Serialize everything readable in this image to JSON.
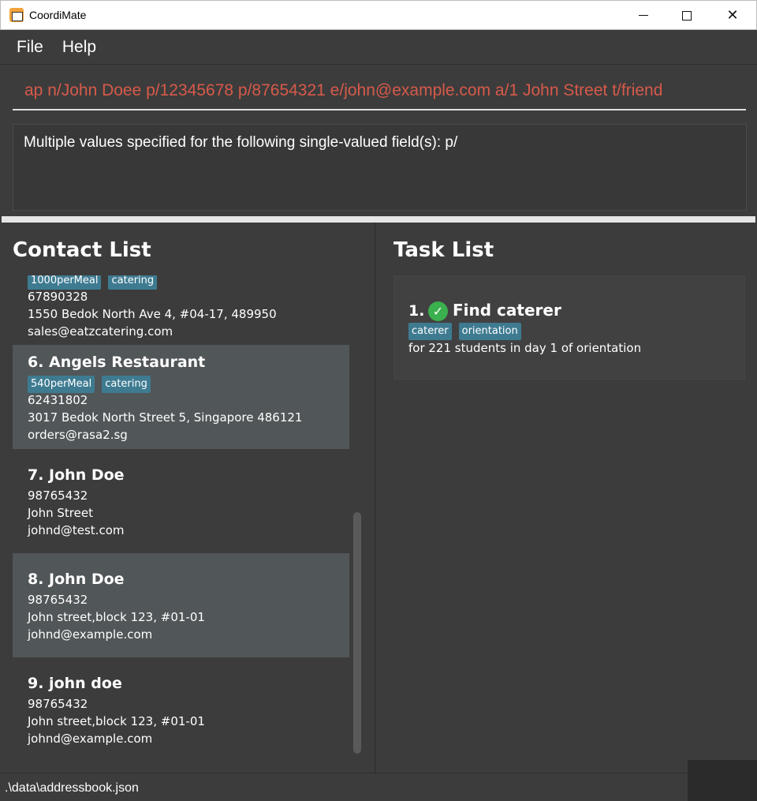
{
  "window": {
    "title": "CoordiMate"
  },
  "menu": [
    {
      "label": "File"
    },
    {
      "label": "Help"
    }
  ],
  "command": {
    "value": "ap n/John Doee p/12345678 p/87654321 e/john@example.com a/1 John Street t/friend"
  },
  "result": {
    "text": "Multiple values specified for the following single-valued field(s): p/"
  },
  "contacts": {
    "title": "Contact List",
    "items": [
      {
        "tags": [
          "1000perMeal",
          "catering"
        ],
        "phone": "67890328",
        "address": "1550 Bedok North Ave 4, #04-17, 489950",
        "email": "sales@eatzcatering.com"
      },
      {
        "name": "6.  Angels Restaurant",
        "tags": [
          "540perMeal",
          "catering"
        ],
        "phone": "62431802",
        "address": "3017 Bedok North Street 5, Singapore 486121",
        "email": "orders@rasa2.sg"
      },
      {
        "name": "7.  John Doe",
        "phone": "98765432",
        "address": "John Street",
        "email": "johnd@test.com"
      },
      {
        "name": "8.  John  Doe",
        "phone": "98765432",
        "address": "John street,block 123, #01-01",
        "email": "johnd@example.com"
      },
      {
        "name": "9.  john doe",
        "phone": "98765432",
        "address": "John street,block 123, #01-01",
        "email": "johnd@example.com"
      }
    ]
  },
  "tasks": {
    "title": "Task List",
    "items": [
      {
        "index": "1.",
        "title": "Find caterer",
        "tags": [
          "caterer",
          "orientation"
        ],
        "description": "for 221 students in day 1 of orientation",
        "done": true
      }
    ]
  },
  "status": {
    "path": ".\\data\\addressbook.json"
  },
  "colors": {
    "background": "#3c3c3c",
    "tag": "#3e7b91",
    "error_text": "#d75a4a",
    "done": "#3bb04e"
  },
  "icons": {
    "app": "calendar-app-icon",
    "done": "check-circle-icon"
  }
}
